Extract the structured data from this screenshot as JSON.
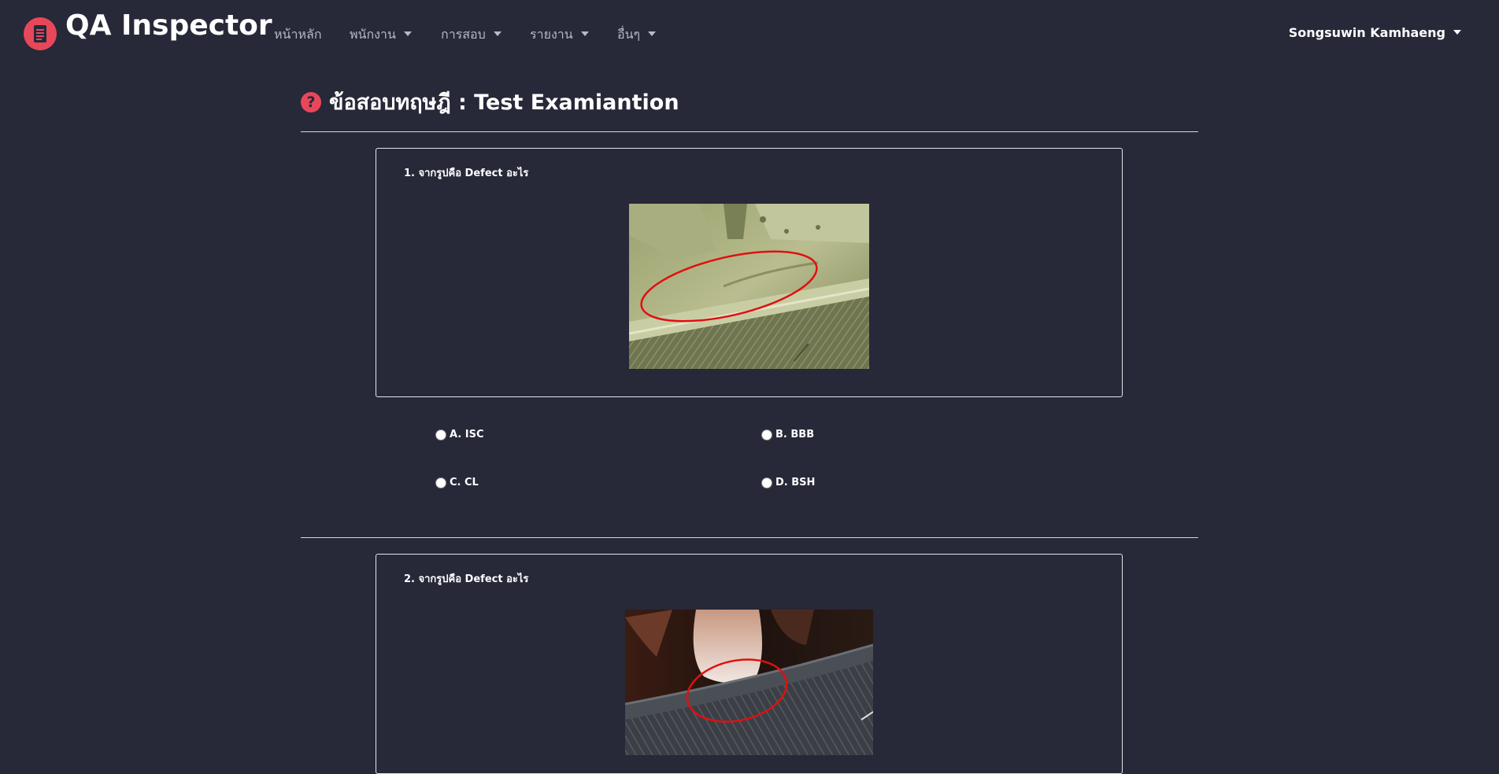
{
  "brand": {
    "title": "QA Inspector",
    "logo_icon": "document-icon"
  },
  "nav": {
    "items": [
      {
        "label": "หน้าหลัก",
        "dropdown": false
      },
      {
        "label": "พนักงาน",
        "dropdown": true
      },
      {
        "label": "การสอบ",
        "dropdown": true
      },
      {
        "label": "รายงาน",
        "dropdown": true
      },
      {
        "label": "อื่นๆ",
        "dropdown": true
      }
    ],
    "user": "Songsuwin Kamhaeng"
  },
  "page": {
    "title": "ข้อสอบทฤษฎี : Test Examiantion",
    "title_icon": "question-circle-icon"
  },
  "questions": [
    {
      "text": "1. จากรูปคือ Defect อะไร",
      "options": [
        "A. ISC",
        "B. BBB",
        "C. CL",
        "D. BSH"
      ]
    },
    {
      "text": "2. จากรูปคือ Defect อะไร"
    }
  ],
  "colors": {
    "background": "#272838",
    "accent": "#e8475a",
    "text": "#ffffff",
    "nav_text": "#b8b9c3"
  }
}
